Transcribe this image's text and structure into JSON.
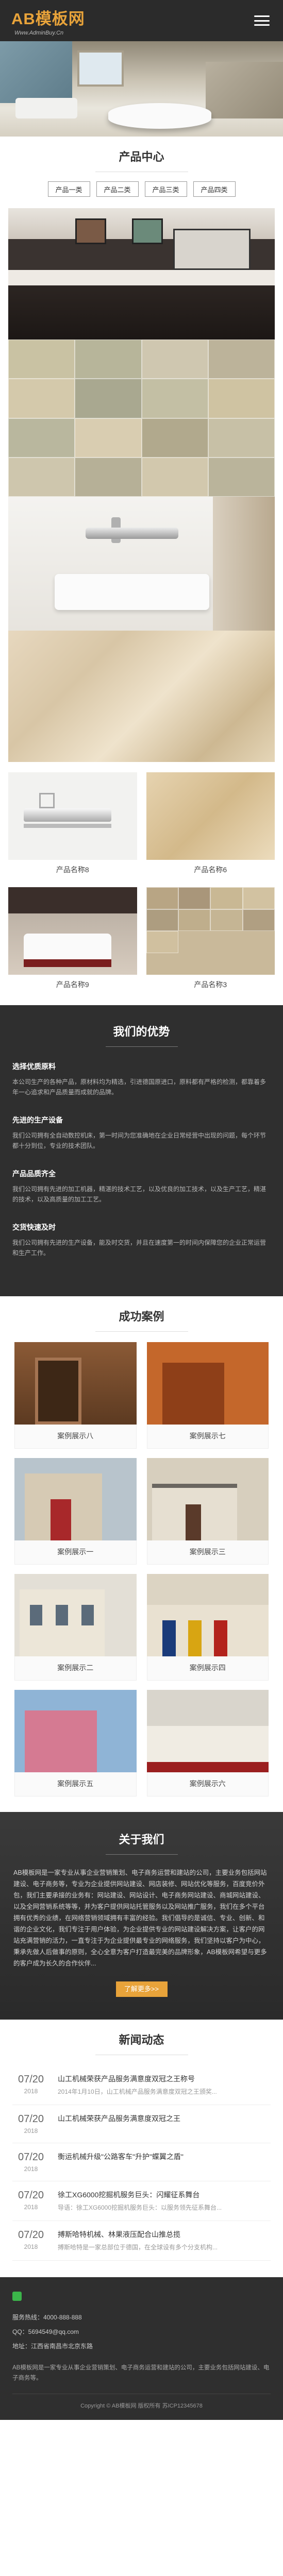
{
  "header": {
    "logo_main": "AB模板网",
    "logo_sub": "Www.AdminBuy.Cn"
  },
  "products": {
    "title": "产品中心",
    "categories": [
      "产品一类",
      "产品二类",
      "产品三类",
      "产品四类"
    ],
    "items": [
      {
        "name": "产品名称8"
      },
      {
        "name": "产品名称6"
      },
      {
        "name": "产品名称9"
      },
      {
        "name": "产品名称3"
      }
    ]
  },
  "advantages": {
    "title": "我们的优势",
    "items": [
      {
        "title": "选择优质原料",
        "text": "本公司生产的各种产品，原材料均为精选，引进德国原进口，原料都有严格的检测，都靠着多年一心追求和产品质量而成就的品牌。"
      },
      {
        "title": "先进的生产设备",
        "text": "我们公司拥有全自动数控机床，第一时间为您准确地在企业日常经营中出现的问题，每个环节都十分到位，专业的技术团队。"
      },
      {
        "title": "产品品质齐全",
        "text": "我们公司拥有先进的加工机器，精湛的技术工艺，以及优良的加工技术，以及生产工艺，精湛的技术，以及高质量的加工工艺。"
      },
      {
        "title": "交货快速及时",
        "text": "我们公司拥有先进的生产设备，能及时交货，并且在速度第一的时间内保障您的企业正常运营和生产工作。"
      }
    ]
  },
  "cases": {
    "title": "成功案例",
    "items": [
      {
        "name": "案例展示八"
      },
      {
        "name": "案例展示七"
      },
      {
        "name": "案例展示一"
      },
      {
        "name": "案例展示三"
      },
      {
        "name": "案例展示二"
      },
      {
        "name": "案例展示四"
      },
      {
        "name": "案例展示五"
      },
      {
        "name": "案例展示六"
      }
    ]
  },
  "about": {
    "title": "关于我们",
    "text": "AB模板网是一家专业从事企业营销策划、电子商务运营和建站的公司，主要业务包括网站建设、电子商务等，专业为企业提供网站建设、网店装修、网站优化等服务，百度竞价外包，我们主要承接的业务有：网站建设、网站设计、电子商务网站建设、商城网站建设、以及全网营销系统等等，并为客户提供网站托管服务以及网站推广服务，我们在多个平台拥有优秀的业绩，在网络营销领域拥有丰富的经验。我们倡导的是诚信、专业、创新、和谐的企业文化，我们专注于用户体验，为企业提供专业的网站建设解决方案，让客户的网站充满营销的活力，一直专注于为企业提供最专业的网络服务，我们坚持以客户为中心，秉承先做人后做事的原则，全心全意为客户打造最完美的品牌形象，AB模板网希望与更多的客户成为长久的合作伙伴...",
    "button": "了解更多>>"
  },
  "news": {
    "title": "新闻动态",
    "items": [
      {
        "md": "07/20",
        "yr": "2018",
        "title": "山工机械荣获产品服务满意度双冠之王称号",
        "summary": "2014年1月10日，山工机械产品服务满意度双冠之王颁奖..."
      },
      {
        "md": "07/20",
        "yr": "2018",
        "title": "山工机械荣获产品服务满意度双冠之王",
        "summary": ""
      },
      {
        "md": "07/20",
        "yr": "2018",
        "title": "衡运机械升级\"公路客车\"升护\"蝶翼之盾\"",
        "summary": ""
      },
      {
        "md": "07/20",
        "yr": "2018",
        "title": "徐工XG6000挖掘机服务巨头：闪耀征系舞台",
        "summary": "导语：徐工XG6000挖掘机服务巨头：以服务领先征系舞台..."
      },
      {
        "md": "07/20",
        "yr": "2018",
        "title": "搏斯哈特机械、林果液压配合山推总揽",
        "summary": "搏斯哈特是一家总部位于德国，在全球设有多个分支机构..."
      }
    ]
  },
  "footer": {
    "phone": "服务热线：4000-888-888",
    "qq": "QQ：5694549@qq.com",
    "address": "地址：江西省南昌市北京东路",
    "desc": "AB模板网是一家专业从事企业营销策划、电子商务运营和建站的公司，主要业务包括网站建设、电子商务等。",
    "copyright": "Copyright © AB模板网 版权所有 苏ICP12345678"
  },
  "colors": {
    "accent": "#e8a33a",
    "dark_bg": "#2f2f2f"
  }
}
